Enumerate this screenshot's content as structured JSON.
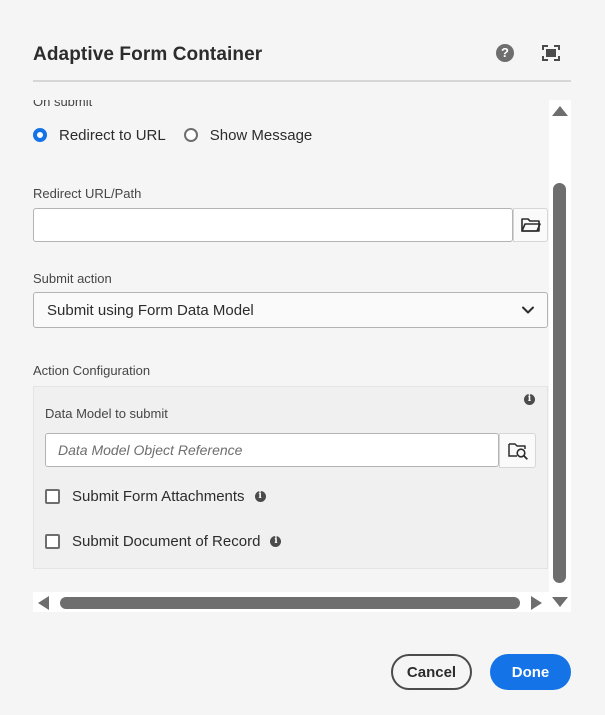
{
  "dialog": {
    "title": "Adaptive Form Container",
    "help_icon": "help-icon",
    "fullscreen_icon": "fullscreen-icon"
  },
  "on_submit": {
    "label": "On submit",
    "options": [
      {
        "label": "Redirect to URL",
        "checked": true
      },
      {
        "label": "Show Message",
        "checked": false
      }
    ]
  },
  "redirect": {
    "label": "Redirect URL/Path",
    "value": "",
    "browse_icon": "folder-icon"
  },
  "submit_action": {
    "label": "Submit action",
    "selected": "Submit using Form Data Model"
  },
  "action_configuration": {
    "label": "Action Configuration",
    "data_model_label": "Data Model to submit",
    "data_model_placeholder": "Data Model Object Reference",
    "data_model_browse_icon": "folder-search-icon",
    "checkboxes": [
      {
        "label": "Submit Form Attachments",
        "checked": false
      },
      {
        "label": "Submit Document of Record",
        "checked": false
      }
    ]
  },
  "footer": {
    "cancel_label": "Cancel",
    "done_label": "Done"
  },
  "colors": {
    "accent": "#1473e6",
    "scrollbar": "#6e6e6e",
    "background": "#f5f5f5"
  }
}
